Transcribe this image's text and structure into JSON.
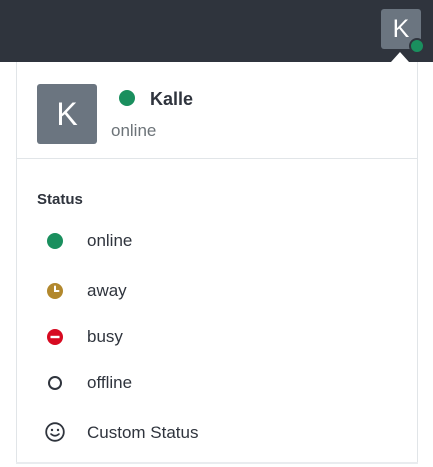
{
  "topbar": {
    "avatar_initial": "K",
    "status_color": "#1a8f5e"
  },
  "user": {
    "avatar_initial": "K",
    "name": "Kalle",
    "status": "online"
  },
  "status_menu": {
    "title": "Status",
    "items": [
      {
        "label": "online",
        "icon": "status-online-icon",
        "color": "#1a8f5e"
      },
      {
        "label": "away",
        "icon": "status-away-icon",
        "color": "#b2882d"
      },
      {
        "label": "busy",
        "icon": "status-busy-icon",
        "color": "#d70a21"
      },
      {
        "label": "offline",
        "icon": "status-offline-icon",
        "color": "#2f343d"
      },
      {
        "label": "Custom Status",
        "icon": "smiley-icon",
        "color": "#2f343d"
      }
    ]
  }
}
